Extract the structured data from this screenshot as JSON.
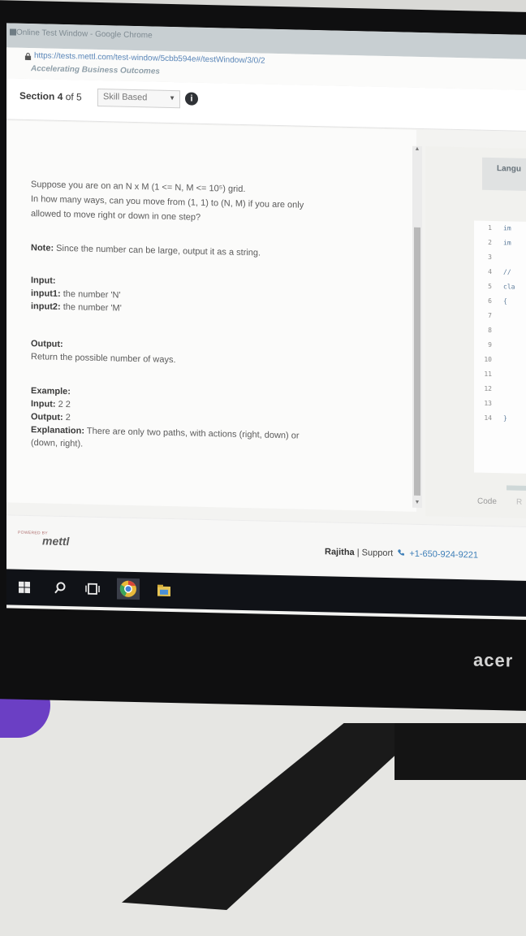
{
  "browser": {
    "title": "Online Test Window - Google Chrome",
    "url": "https://tests.mettl.com/test-window/5cbb594e#/testWindow/3/0/2",
    "tagline": "Accelerating Business Outcomes"
  },
  "section": {
    "prefix": "Section",
    "current": "4",
    "of_text": "of 5",
    "dropdown_value": "Skill Based"
  },
  "question": {
    "line1": "Suppose you are on an N x M (1 <= N, M <= 10⁵) grid.",
    "line2": "In how many ways, can you move from (1, 1) to (N, M) if you are only",
    "line3": "allowed to move right or down in one step?",
    "note_label": "Note:",
    "note_text": "Since the number can be large, output it as a string.",
    "input_label": "Input:",
    "input1_label": "input1:",
    "input1_text": "the number 'N'",
    "input2_label": "input2:",
    "input2_text": "the number 'M'",
    "output_label": "Output:",
    "output_text": "Return the possible number of ways.",
    "example_label": "Example:",
    "ex_input_label": "Input:",
    "ex_input_value": "2 2",
    "ex_output_label": "Output:",
    "ex_output_value": "2",
    "explanation_label": "Explanation:",
    "explanation_line1": "There are only two paths, with actions (right, down) or",
    "explanation_line2": "(down, right)."
  },
  "editor": {
    "language_label": "Langu",
    "line_numbers": [
      "1",
      "2",
      "3",
      "4",
      "5",
      "6",
      "7",
      "8",
      "9",
      "10",
      "11",
      "12",
      "13",
      "14"
    ],
    "code_lines": [
      "im",
      "im",
      "",
      "//",
      "cla",
      "{",
      "",
      "",
      "",
      "",
      "",
      "",
      "",
      "}"
    ],
    "tab_code": "Code",
    "tab_other": "R"
  },
  "footer": {
    "powered_by": "POWERED BY",
    "logo": "mettl",
    "user": "Rajitha",
    "support": "Support",
    "phone": "+1-650-924-9221"
  },
  "device": {
    "brand": "acer"
  }
}
